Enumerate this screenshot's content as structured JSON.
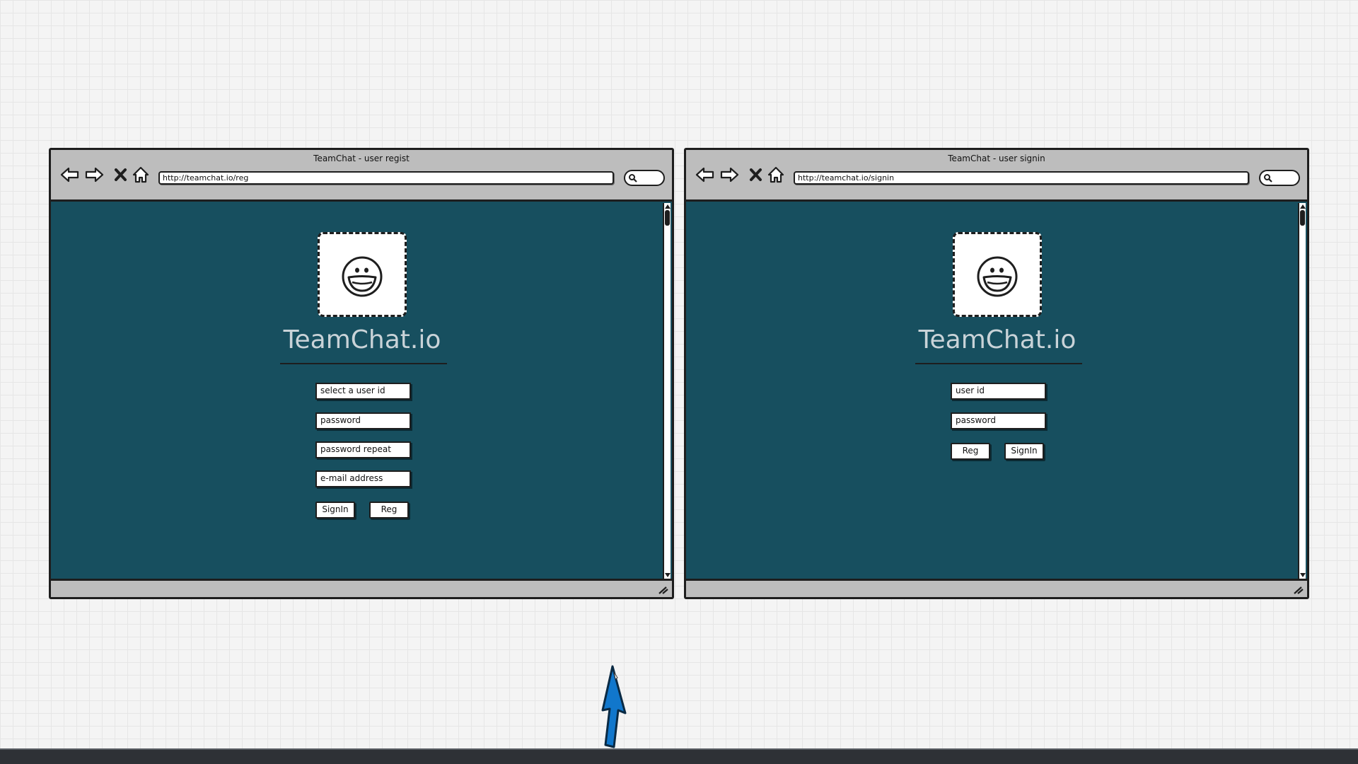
{
  "left_window": {
    "title": "TeamChat - user regist",
    "url": "http://teamchat.io/reg",
    "brand": "TeamChat.io",
    "fields": {
      "user_id_placeholder": "select a user id",
      "password_placeholder": "password",
      "password_repeat_placeholder": "password repeat",
      "email_placeholder": "e-mail address"
    },
    "buttons": {
      "signin": "SignIn",
      "reg": "Reg"
    }
  },
  "right_window": {
    "title": "TeamChat - user signin",
    "url": "http://teamchat.io/signin",
    "brand": "TeamChat.io",
    "fields": {
      "user_id_placeholder": "user id",
      "password_placeholder": "password"
    },
    "buttons": {
      "reg": "Reg",
      "signin": "SignIn"
    }
  },
  "icons": {
    "back": "back-arrow-icon",
    "forward": "forward-arrow-icon",
    "stop": "close-icon",
    "home": "home-icon",
    "search": "search-icon",
    "logo": "smiley-face-icon",
    "cursor": "mouse-pointer-icon"
  },
  "colors": {
    "content_background": "#174f5f",
    "chrome_background": "#bdbdbd",
    "brand_text": "#c9d3d8",
    "cursor": "#1177cc"
  }
}
